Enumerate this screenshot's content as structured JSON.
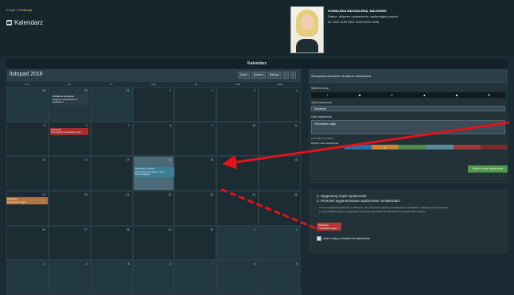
{
  "header": {
    "breadcrumb": {
      "home": "Kokpit",
      "sep": "/",
      "current": "Publikacje"
    },
    "title": "Kalendarz",
    "user": {
      "name": "KOWALSKA MAGDALENA, WA-000000",
      "status": "Status: aktywne uprawnienia, wydarzający zawód",
      "phone": "64 1910 1152 0511 0000 0002 0446"
    }
  },
  "calendar": {
    "section_title": "Kalendarz",
    "month_label": "listopad 2018",
    "view_buttons": [
      "Dzień",
      "Tydzień",
      "Miesiąc"
    ],
    "nav": {
      "prev": "‹",
      "next": "›"
    },
    "weekdays": [
      "pon",
      "wt",
      "śr",
      "czw",
      "pt",
      "sob",
      "niedz"
    ],
    "weeks": [
      [
        "29",
        "30",
        "31",
        "1",
        "2",
        "3",
        "4"
      ],
      [
        "5",
        "6",
        "7",
        "8",
        "9",
        "10",
        "11"
      ],
      [
        "12",
        "13",
        "14",
        "15",
        "16",
        "17",
        "18"
      ],
      [
        "19",
        "20",
        "21",
        "22",
        "23",
        "24",
        "25"
      ],
      [
        "26",
        "27",
        "28",
        "29",
        "30",
        "1",
        "2"
      ],
      [
        "3",
        "4",
        "5",
        "6",
        "7",
        "8",
        "9"
      ]
    ],
    "events": [
      {
        "id": "e1",
        "title": "Dokładnie spotkanie",
        "sub": "Drużyna: konsultacje ze studentem"
      },
      {
        "id": "e2",
        "title": "Szkolenie",
        "sub": "Ponowienie ostatniego cyklu"
      },
      {
        "id": "e3",
        "title": "Spotkanie zespołu",
        "sub": "prezentacja wyników i nowy harmonogram"
      },
      {
        "id": "e4",
        "title": "Szkolenie",
        "sub": "Ponowienie zajęć"
      }
    ]
  },
  "editor": {
    "heading": "Zarządzaj zakresem i dodaj do kalendarza",
    "icon_label": "Wybierz ikonę",
    "icons": [
      "i",
      "person-icon",
      "check-icon",
      "doc-icon",
      "person-icon",
      "gear-icon"
    ],
    "title_label": "Tytuł wydarzenia",
    "title_value": "Szkolenie",
    "desc_label": "Opis wydarzenia",
    "desc_value": "Ponowienie zajęć",
    "length_label": "pozostało 15 znaków",
    "color_label": "Wybierz kolor wydarzenia",
    "colors": [
      "#2f6fa7",
      "#c8863a",
      "#4d8a4c",
      "#5a8a96",
      "#9b3a3a",
      "#7a2c2c"
    ],
    "create_button": "Utwórz nowe wydarzenie"
  },
  "help": {
    "steps": [
      "1. Wygeneruj nowe wydarzenie",
      "2. Przenieś wygenerowane wydarzenie na kalendarz"
    ],
    "notes": [
      "Tu uzyj nawigacji wydarzenia po kliknięciu, aby przesunąć między poszczególnymi miesiącami i nawigacją na przesunięcie",
      "Tu uzyj ustawień godziny wydarzenia przeciwnej tak wieloletnim zaznaczeniem poprzedniej i kolejnej"
    ],
    "draft_event": {
      "title": "Szkolenie",
      "sub": "Ponowienie zajęć"
    },
    "remove_checkbox": "usuń z listy po dodaniu do kalendarza"
  }
}
